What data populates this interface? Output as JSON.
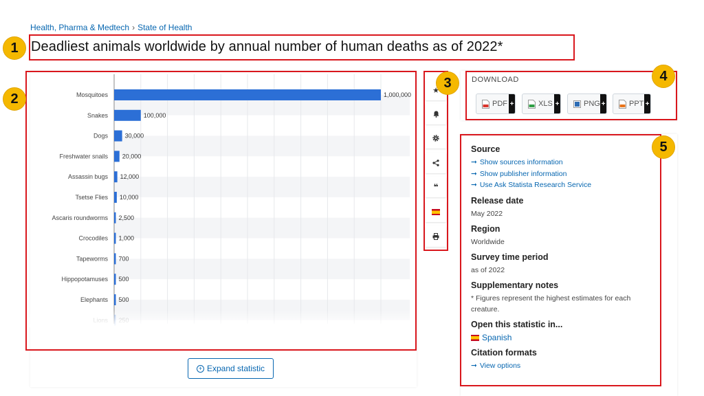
{
  "breadcrumb": {
    "category": "Health, Pharma & Medtech",
    "separator": "›",
    "topic": "State of Health"
  },
  "title": "Deadliest animals worldwide by annual number of human deaths as of 2022*",
  "badges": [
    "1",
    "2",
    "3",
    "4",
    "5"
  ],
  "chart_data": {
    "type": "bar",
    "orientation": "horizontal",
    "categories": [
      "Mosquitoes",
      "Snakes",
      "Dogs",
      "Freshwater snails",
      "Assassin bugs",
      "Tsetse Flies",
      "Ascaris roundworms",
      "Crocodiles",
      "Tapeworms",
      "Hippopotamuses",
      "Elephants",
      "Lions"
    ],
    "values": [
      1000000,
      100000,
      30000,
      20000,
      12000,
      10000,
      2500,
      1000,
      700,
      500,
      500,
      250
    ],
    "value_labels": [
      "1,000,000",
      "100,000",
      "30,000",
      "20,000",
      "12,000",
      "10,000",
      "2,500",
      "1,000",
      "700",
      "500",
      "500",
      "250"
    ],
    "xlim": [
      0,
      1000000
    ],
    "grid": true,
    "bar_color": "#2c6fd6"
  },
  "expand_label": "Expand statistic",
  "toolbar": [
    {
      "icon": "star-icon",
      "glyph": "★"
    },
    {
      "icon": "bell-icon",
      "glyph": "bell"
    },
    {
      "icon": "gear-icon",
      "glyph": "gear"
    },
    {
      "icon": "share-icon",
      "glyph": "share"
    },
    {
      "icon": "quote-icon",
      "glyph": "❝"
    },
    {
      "icon": "spanish-flag-icon",
      "glyph": "flag"
    },
    {
      "icon": "print-icon",
      "glyph": "print"
    }
  ],
  "download": {
    "title": "DOWNLOAD",
    "buttons": [
      {
        "label": "PDF",
        "color": "#d9342b"
      },
      {
        "label": "XLS",
        "color": "#2f9e44"
      },
      {
        "label": "PNG",
        "color": "#2d6cb5"
      },
      {
        "label": "PPT",
        "color": "#e8731a"
      }
    ],
    "plus": "+"
  },
  "info": {
    "source_heading": "Source",
    "source_links": [
      "Show sources information",
      "Show publisher information",
      "Use Ask Statista Research Service"
    ],
    "release_heading": "Release date",
    "release_value": "May 2022",
    "region_heading": "Region",
    "region_value": "Worldwide",
    "survey_heading": "Survey time period",
    "survey_value": "as of 2022",
    "notes_heading": "Supplementary notes",
    "notes_value": "* Figures represent the highest estimates for each creature.",
    "open_heading": "Open this statistic in...",
    "open_value": "Spanish",
    "citation_heading": "Citation formats",
    "citation_link": "View options"
  },
  "arrow": "➞"
}
